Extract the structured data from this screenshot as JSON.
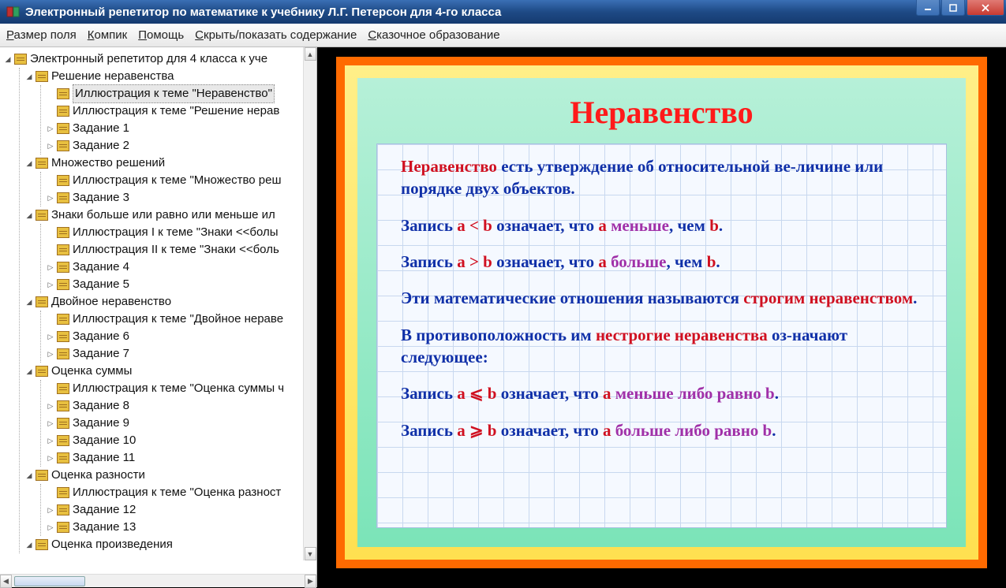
{
  "window": {
    "title": "Электронный репетитор по математике к учебнику Л.Г. Петерсон для 4-го класса"
  },
  "menu": {
    "m1": "Размер поля",
    "m2": "Компик",
    "m3": "Помощь",
    "m4": "Скрыть/показать содержание",
    "m5": "Сказочное образование"
  },
  "tree": {
    "root": "Электронный репетитор для 4 класса к уче",
    "g1": {
      "title": "Решение неравенства",
      "i1": "Иллюстрация к теме \"Неравенство\"",
      "i2": "Иллюстрация к теме \"Решение нерав",
      "i3": "Задание 1",
      "i4": "Задание 2"
    },
    "g2": {
      "title": "Множество решений",
      "i1": "Иллюстрация к теме \"Множество реш",
      "i2": "Задание 3"
    },
    "g3": {
      "title": "Знаки больше или равно или меньше ил",
      "i1": "Иллюстрация I к теме \"Знаки <<болы",
      "i2": "Иллюстрация II к теме \"Знаки <<боль",
      "i3": "Задание 4",
      "i4": "Задание 5"
    },
    "g4": {
      "title": "Двойное неравенство",
      "i1": "Иллюстрация к теме \"Двойное нераве",
      "i2": "Задание 6",
      "i3": "Задание 7"
    },
    "g5": {
      "title": "Оценка суммы",
      "i1": "Иллюстрация к теме \"Оценка суммы ч",
      "i2": "Задание 8",
      "i3": "Задание 9",
      "i4": "Задание 10",
      "i5": "Задание 11"
    },
    "g6": {
      "title": "Оценка разности",
      "i1": "Иллюстрация к теме \"Оценка разност",
      "i2": "Задание 12",
      "i3": "Задание 13"
    },
    "g7": {
      "title": "Оценка произведения"
    }
  },
  "page": {
    "title": "Неравенство",
    "p1a": "Неравенство",
    "p1b": " есть утверждение об относительной ве-личине или порядке двух объектов.",
    "p2a": "Запись ",
    "p2b": "a < b",
    "p2c": " означает, что ",
    "p2d": "a",
    "p2e": " меньше",
    "p2f": ", чем ",
    "p2g": "b",
    "p2h": ".",
    "p3a": "Запись ",
    "p3b": "a > b",
    "p3c": " означает, что ",
    "p3d": "a",
    "p3e": " больше",
    "p3f": ", чем ",
    "p3g": "b",
    "p3h": ".",
    "p4a": "Эти математические отношения называются ",
    "p4b": "строгим неравенством",
    "p4c": ".",
    "p5a": "В противоположность им ",
    "p5b": "нестрогие неравенства",
    "p5c": " оз-начают следующее:",
    "p6a": "Запись ",
    "p6b": "a ⩽ b",
    "p6c": " означает, что ",
    "p6d": "a",
    "p6e": " меньше либо равно b",
    "p6f": ".",
    "p7a": "Запись ",
    "p7b": "a ⩾ b",
    "p7c": " означает, что ",
    "p7d": "a",
    "p7e": " больше либо равно b",
    "p7f": "."
  }
}
